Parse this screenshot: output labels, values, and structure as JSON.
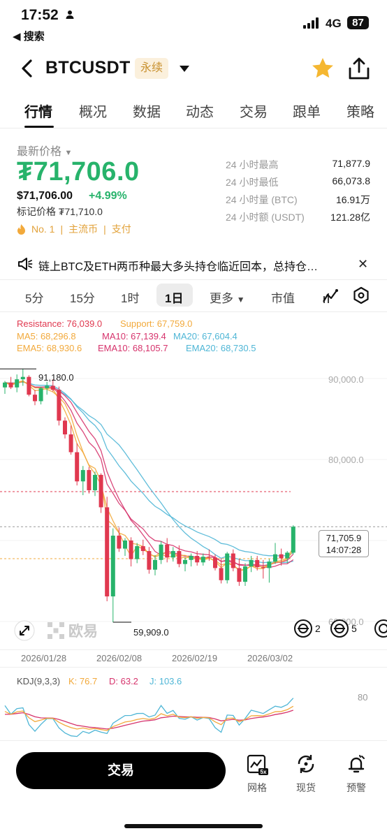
{
  "status": {
    "time": "17:52",
    "back_app": "◀ 搜索",
    "network": "4G",
    "battery": "87"
  },
  "header": {
    "title": "BTCUSDT",
    "badge": "永续"
  },
  "tabs": [
    "行情",
    "概况",
    "数据",
    "动态",
    "交易",
    "跟单",
    "策略"
  ],
  "price": {
    "label": "最新价格",
    "last": "₮71,706.0",
    "usd": "$71,706.00",
    "change": "+4.99%",
    "mark": "标记价格 ₮71,710.0",
    "tags": [
      "No. 1",
      "主流币",
      "支付"
    ]
  },
  "stats": [
    {
      "label": "24 小时最高",
      "value": "71,877.9"
    },
    {
      "label": "24 小时最低",
      "value": "66,073.8"
    },
    {
      "label": "24 小时量 (BTC)",
      "value": "16.91万"
    },
    {
      "label": "24 小时额 (USDT)",
      "value": "121.28亿"
    }
  ],
  "announcement": "链上BTC及ETH两币种最大多头持仓临近回本，总持仓…",
  "intervals": {
    "items": [
      "5分",
      "15分",
      "1时",
      "1日"
    ],
    "more": "更多",
    "market_cap": "市值",
    "active": "1日"
  },
  "chart_legend": {
    "resistance": "Resistance: 76,039.0",
    "support": "Support: 67,759.0",
    "ma5": "MA5: 68,296.8",
    "ma10": "MA10: 67,139.4",
    "ma20": "MA20: 67,604.4",
    "ema5": "EMA5: 68,930.6",
    "ema10": "EMA10: 68,105.7",
    "ema20": "EMA20: 68,730.5"
  },
  "chart_labels": {
    "high": "91,180.0",
    "low": "59,909.0",
    "current_price": "71,705.9",
    "countdown": "14:07:28",
    "watermark": "欧易",
    "badge_a": "2",
    "badge_b": "5",
    "y_axis": [
      "90,000.0",
      "80,000.0",
      "60,000.0"
    ],
    "x_axis": [
      "2026/01/28",
      "2026/02/08",
      "2026/02/19",
      "2026/03/02"
    ]
  },
  "kdj": {
    "title": "KDJ(9,3,3)",
    "k": "K: 76.7",
    "d": "D: 63.2",
    "j": "J: 103.6",
    "axis": "80"
  },
  "bottom": {
    "trade": "交易",
    "grid": "网格",
    "spot": "现货",
    "alert": "预警"
  },
  "colors": {
    "up": "#27b36b",
    "down": "#e0384f",
    "resistance": "#e0384f",
    "support": "#f2a93b",
    "ma5": "#f2a93b",
    "ma10": "#d6336c",
    "ma20": "#4fb6d6",
    "badge_bg": "#fbf0dc",
    "badge_text": "#c8902e"
  },
  "chart_data": {
    "type": "candlestick",
    "y_axis_ticks": [
      90000,
      80000,
      60000
    ],
    "ylim": [
      59000,
      93000
    ],
    "x_ticks": [
      "2026/01/28",
      "2026/02/08",
      "2026/02/19",
      "2026/03/02"
    ],
    "candles": [
      [
        88900,
        89700,
        88100,
        89500
      ],
      [
        89500,
        90200,
        88700,
        88900
      ],
      [
        88900,
        90500,
        88300,
        89900
      ],
      [
        89900,
        91180,
        89100,
        90200
      ],
      [
        90200,
        90400,
        87800,
        88000
      ],
      [
        88000,
        88600,
        86700,
        87200
      ],
      [
        87200,
        89000,
        86800,
        88800
      ],
      [
        88800,
        89600,
        88000,
        89100
      ],
      [
        89100,
        89900,
        88400,
        88600
      ],
      [
        88600,
        89000,
        84200,
        84800
      ],
      [
        84800,
        85200,
        82600,
        83100
      ],
      [
        83100,
        84200,
        80600,
        80900
      ],
      [
        80900,
        82000,
        76800,
        77300
      ],
      [
        77300,
        79200,
        75600,
        78700
      ],
      [
        78700,
        79100,
        75800,
        76200
      ],
      [
        76200,
        78500,
        75500,
        78100
      ],
      [
        78100,
        78300,
        73400,
        74100
      ],
      [
        74100,
        75400,
        62500,
        63100
      ],
      [
        63100,
        71500,
        59909,
        70600
      ],
      [
        70600,
        71600,
        68600,
        69000
      ],
      [
        69000,
        70300,
        68100,
        70000
      ],
      [
        70000,
        70400,
        66800,
        67700
      ],
      [
        67700,
        69700,
        67200,
        69300
      ],
      [
        69300,
        70100,
        68200,
        68700
      ],
      [
        68700,
        69200,
        65900,
        66400
      ],
      [
        66400,
        68200,
        65700,
        67600
      ],
      [
        67600,
        69900,
        67100,
        69500
      ],
      [
        69500,
        70300,
        67300,
        67900
      ],
      [
        67900,
        69200,
        67400,
        68700
      ],
      [
        68700,
        69400,
        66700,
        67100
      ],
      [
        67100,
        67900,
        66200,
        67600
      ],
      [
        67600,
        68400,
        66800,
        68100
      ],
      [
        68100,
        68700,
        66900,
        67300
      ],
      [
        67300,
        68400,
        66900,
        68000
      ],
      [
        68000,
        68900,
        67500,
        67900
      ],
      [
        67900,
        68300,
        66300,
        66600
      ],
      [
        66600,
        67800,
        64700,
        65100
      ],
      [
        65100,
        68600,
        64700,
        68400
      ],
      [
        68400,
        68900,
        66200,
        66600
      ],
      [
        66600,
        67700,
        64400,
        64900
      ],
      [
        64900,
        67200,
        64400,
        66800
      ],
      [
        66800,
        68100,
        66100,
        67600
      ],
      [
        67600,
        68100,
        66300,
        66700
      ],
      [
        66700,
        67600,
        65300,
        66600
      ],
      [
        66600,
        67700,
        64800,
        67400
      ],
      [
        67400,
        69700,
        67100,
        68300
      ],
      [
        68300,
        69000,
        66900,
        67800
      ],
      [
        67800,
        68700,
        67200,
        68500
      ],
      [
        68500,
        71877.9,
        68300,
        71706
      ]
    ],
    "indicators": {
      "resistance": 76039.0,
      "support": 67759.0,
      "ma5": 68296.8,
      "ma10": 67139.4,
      "ma20": 67604.4,
      "ema5": 68930.6,
      "ema10": 68105.7,
      "ema20": 68730.5
    },
    "markers": {
      "high": 91180.0,
      "low": 59909.0,
      "last": 71705.9
    },
    "kdj": {
      "k": 76.7,
      "d": 63.2,
      "j": 103.6,
      "axis_tick": 80
    }
  }
}
